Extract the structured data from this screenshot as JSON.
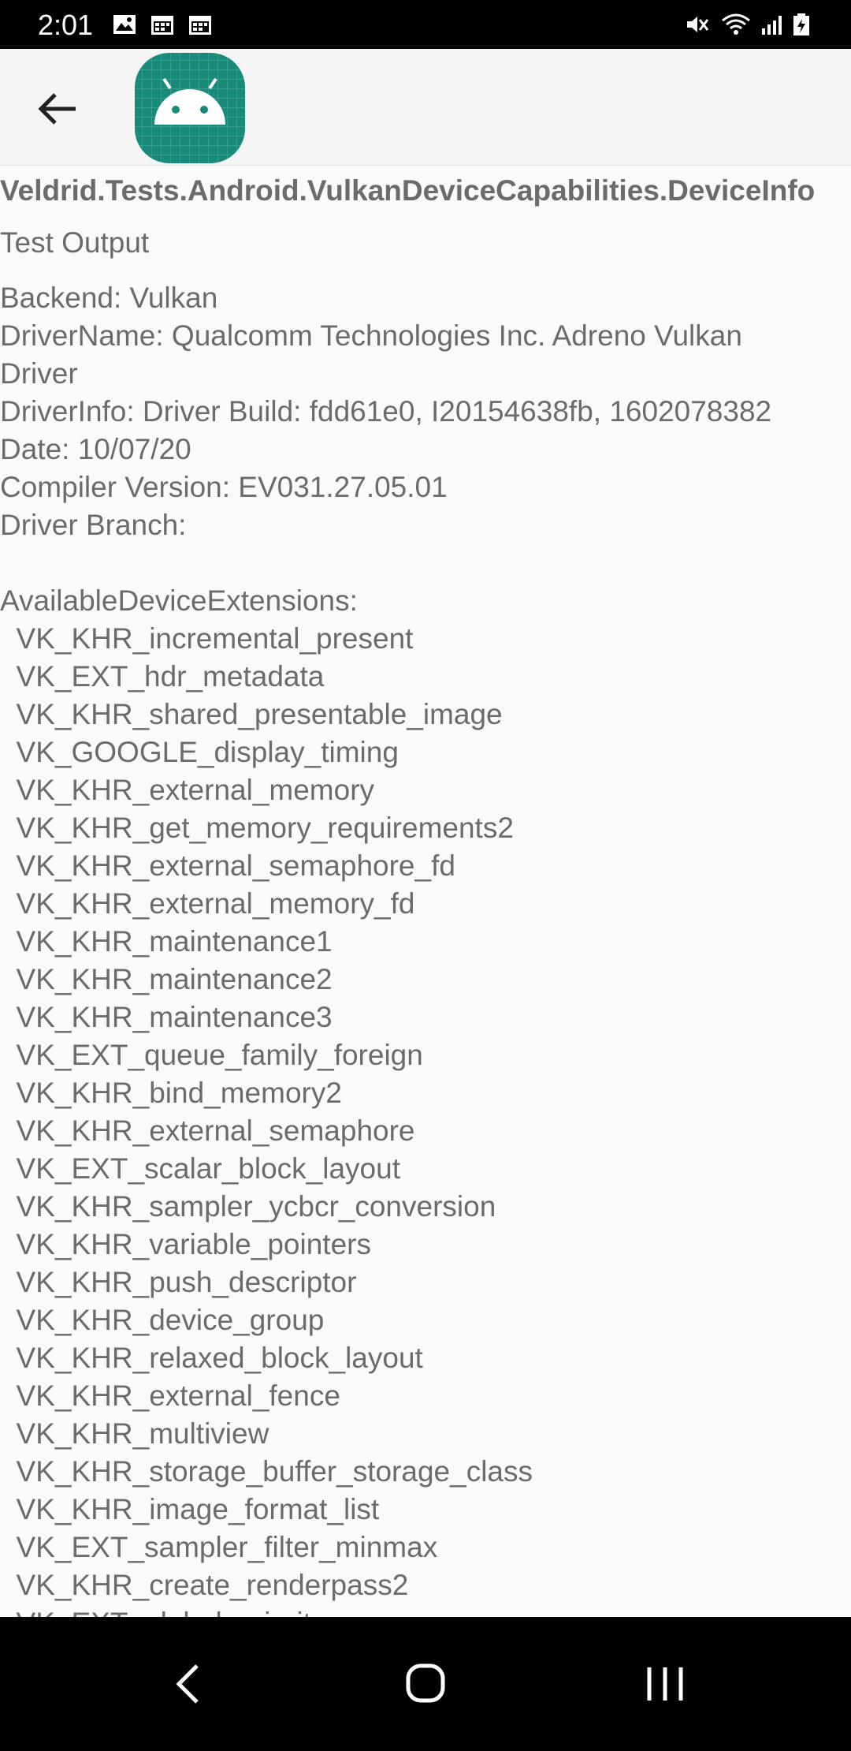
{
  "status_bar": {
    "time": "2:01",
    "left_icons": [
      "image-icon",
      "calendar-icon",
      "calendar-icon"
    ],
    "right_icons": [
      "mute-icon",
      "wifi-icon",
      "signal-icon",
      "battery-charging-icon"
    ]
  },
  "app_bar": {
    "back_icon": "arrow-back-icon",
    "app_icon": "android-robot-icon",
    "accent_color": "#178a7a"
  },
  "test": {
    "name": "Veldrid.Tests.Android.VulkanDeviceCapabilities.DeviceInfo",
    "section_label": "Test Output",
    "lines": [
      "Backend: Vulkan",
      "DriverName: Qualcomm Technologies Inc. Adreno Vulkan",
      "Driver",
      "DriverInfo: Driver Build: fdd61e0, I20154638fb, 1602078382",
      "Date: 10/07/20",
      "Compiler Version: EV031.27.05.01",
      "Driver Branch:",
      "",
      "AvailableDeviceExtensions:",
      "  VK_KHR_incremental_present",
      "  VK_EXT_hdr_metadata",
      "  VK_KHR_shared_presentable_image",
      "  VK_GOOGLE_display_timing",
      "  VK_KHR_external_memory",
      "  VK_KHR_get_memory_requirements2",
      "  VK_KHR_external_semaphore_fd",
      "  VK_KHR_external_memory_fd",
      "  VK_KHR_maintenance1",
      "  VK_KHR_maintenance2",
      "  VK_KHR_maintenance3",
      "  VK_EXT_queue_family_foreign",
      "  VK_KHR_bind_memory2",
      "  VK_KHR_external_semaphore",
      "  VK_EXT_scalar_block_layout",
      "  VK_KHR_sampler_ycbcr_conversion",
      "  VK_KHR_variable_pointers",
      "  VK_KHR_push_descriptor",
      "  VK_KHR_device_group",
      "  VK_KHR_relaxed_block_layout",
      "  VK_KHR_external_fence",
      "  VK_KHR_multiview",
      "  VK_KHR_storage_buffer_storage_class",
      "  VK_KHR_image_format_list",
      "  VK_EXT_sampler_filter_minmax",
      "  VK_KHR_create_renderpass2",
      "  VK_EXT_global_priority"
    ]
  },
  "nav_bar": {
    "back_icon": "nav-back-icon",
    "home_icon": "nav-home-icon",
    "recents_icon": "nav-recents-icon"
  }
}
